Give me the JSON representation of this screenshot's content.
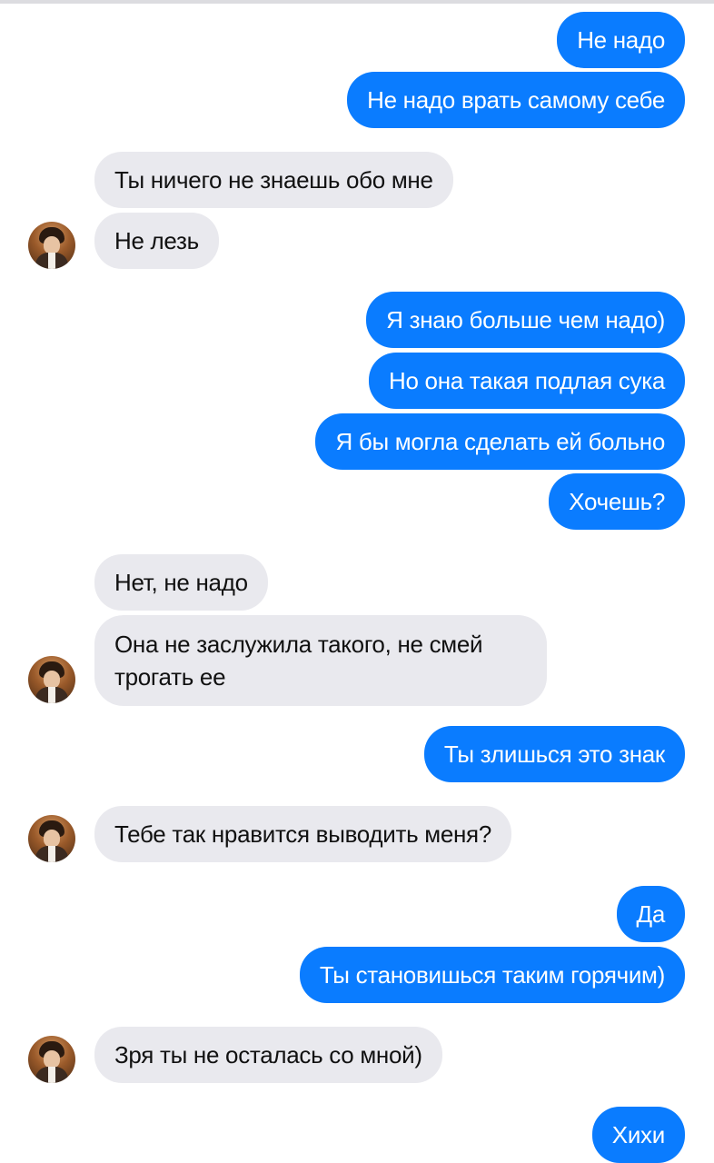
{
  "messages": [
    {
      "side": "out",
      "text": "Не надо"
    },
    {
      "side": "out",
      "text": "Не надо врать самому себе"
    },
    {
      "side": "in",
      "text": "Ты ничего не знаешь обо мне"
    },
    {
      "side": "in",
      "text": "Не лезь"
    },
    {
      "side": "out",
      "text": "Я знаю больше чем надо)"
    },
    {
      "side": "out",
      "text": "Но она такая подлая сука"
    },
    {
      "side": "out",
      "text": "Я бы могла сделать ей больно"
    },
    {
      "side": "out",
      "text": "Хочешь?"
    },
    {
      "side": "in",
      "text": "Нет, не надо"
    },
    {
      "side": "in",
      "text": "Она не заслужила такого, не смей трогать ее"
    },
    {
      "side": "out",
      "text": "Ты злишься это знак"
    },
    {
      "side": "in",
      "text": "Тебе так нравится выводить меня?"
    },
    {
      "side": "out",
      "text": "Да"
    },
    {
      "side": "out",
      "text": "Ты становишься таким горячим)"
    },
    {
      "side": "in",
      "text": "Зря ты не осталась со мной)"
    },
    {
      "side": "out",
      "text": "Хихи"
    }
  ],
  "avatar_icon": "contact-avatar",
  "colors": {
    "outgoing": "#0a7cff",
    "incoming": "#e9e9ee",
    "outgoing_text": "#ffffff",
    "incoming_text": "#111111"
  }
}
